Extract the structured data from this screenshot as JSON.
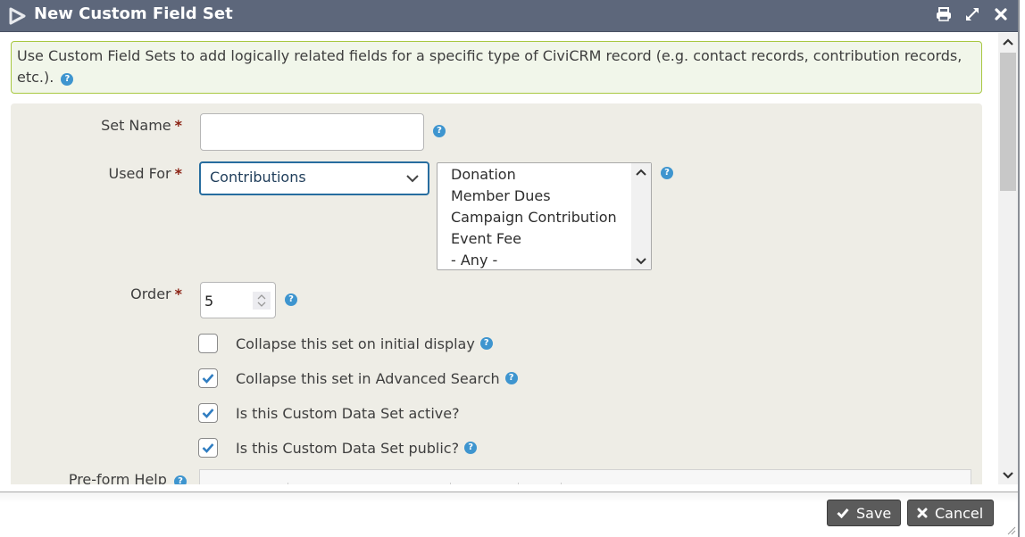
{
  "dialog": {
    "title": "New Custom Field Set",
    "icons": [
      "print-icon",
      "expand-icon",
      "close-icon"
    ]
  },
  "help": {
    "text": "Use Custom Field Sets to add logically related fields for a specific type of CiviCRM record (e.g. contact records, contribution records, etc.).",
    "icon": "?"
  },
  "form": {
    "required_marker": "*",
    "set_name": {
      "label": "Set Name",
      "value": "",
      "placeholder": ""
    },
    "used_for": {
      "label": "Used For",
      "selected": "Contributions",
      "subtypes": [
        "Donation",
        "Member Dues",
        "Campaign Contribution",
        "Event Fee",
        "- Any -"
      ]
    },
    "order": {
      "label": "Order",
      "value": "5"
    },
    "checkboxes": [
      {
        "label": "Collapse this set on initial display",
        "checked": false,
        "help": true
      },
      {
        "label": "Collapse this set in Advanced Search",
        "checked": true,
        "help": true
      },
      {
        "label": "Is this Custom Data Set active?",
        "checked": true,
        "help": false
      },
      {
        "label": "Is this Custom Data Set public?",
        "checked": true,
        "help": true
      }
    ],
    "pre_form_help": {
      "label": "Pre-form Help"
    }
  },
  "footer": {
    "save_label": "Save",
    "cancel_label": "Cancel"
  },
  "colors": {
    "titlebar": "#5d677b",
    "help_border": "#a8c841",
    "help_bg": "#f1f6ea",
    "accent": "#3e95cf",
    "required": "#8a1f11",
    "button": "#5b5b5b"
  }
}
